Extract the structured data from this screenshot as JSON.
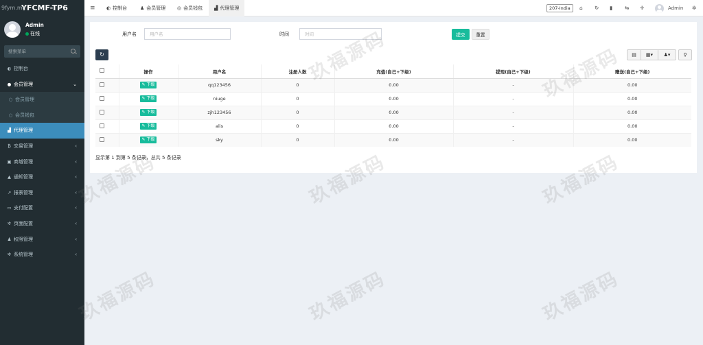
{
  "watermark": "9fym.me",
  "brand": "YFCMF-TP6",
  "user": {
    "name": "Admin",
    "status": "在线"
  },
  "sidebar_search": {
    "placeholder": "搜索菜单"
  },
  "menu": [
    {
      "label": "控制台",
      "icon": "dashboard-icon"
    },
    {
      "label": "会员管理",
      "icon": "user-circle-icon"
    },
    {
      "label": "会员管理",
      "icon": "circle-icon"
    },
    {
      "label": "会员钱包",
      "icon": "circle-icon"
    },
    {
      "label": "代理管理",
      "icon": "sitemap-icon"
    },
    {
      "label": "交易管理",
      "icon": "bitcoin-icon"
    },
    {
      "label": "商城管理",
      "icon": "shop-icon"
    },
    {
      "label": "通知管理",
      "icon": "bell-icon"
    },
    {
      "label": "报表管理",
      "icon": "line-chart-icon"
    },
    {
      "label": "支付配置",
      "icon": "credit-card-icon"
    },
    {
      "label": "页面配置",
      "icon": "gear-icon"
    },
    {
      "label": "权限管理",
      "icon": "users-icon"
    },
    {
      "label": "系统管理",
      "icon": "gears-icon"
    }
  ],
  "tabs": [
    {
      "label": "控制台",
      "icon": "dashboard-icon"
    },
    {
      "label": "会员管理",
      "icon": "user-icon"
    },
    {
      "label": "会员钱包",
      "icon": "circle-icon"
    },
    {
      "label": "代理管理",
      "icon": "sitemap-icon"
    }
  ],
  "header": {
    "lang": "207-India",
    "user": "Admin"
  },
  "filter": {
    "username_label": "用户名",
    "username_placeholder": "用户名",
    "time_label": "时间",
    "time_placeholder": "时间",
    "submit": "提交",
    "reset": "重置"
  },
  "table": {
    "headers": [
      "操作",
      "用户名",
      "注册人数",
      "充值(自己+下级)",
      "提现(自己+下级)",
      "赠送(自己+下级)"
    ],
    "sub_label": "下级",
    "rows": [
      {
        "username": "qq123456",
        "registered": "0",
        "recharge": "0.00",
        "withdraw": "-",
        "gift": "0.00"
      },
      {
        "username": "niuge",
        "registered": "0",
        "recharge": "0.00",
        "withdraw": "-",
        "gift": "0.00"
      },
      {
        "username": "zjh123456",
        "registered": "0",
        "recharge": "0.00",
        "withdraw": "-",
        "gift": "0.00"
      },
      {
        "username": "alis",
        "registered": "0",
        "recharge": "0.00",
        "withdraw": "-",
        "gift": "0.00"
      },
      {
        "username": "sky",
        "registered": "0",
        "recharge": "0.00",
        "withdraw": "-",
        "gift": "0.00"
      }
    ]
  },
  "pager": {
    "info": "显示第 1 到第 5 条记录，总共 5 条记录"
  },
  "watermark_text": "玖福源码"
}
